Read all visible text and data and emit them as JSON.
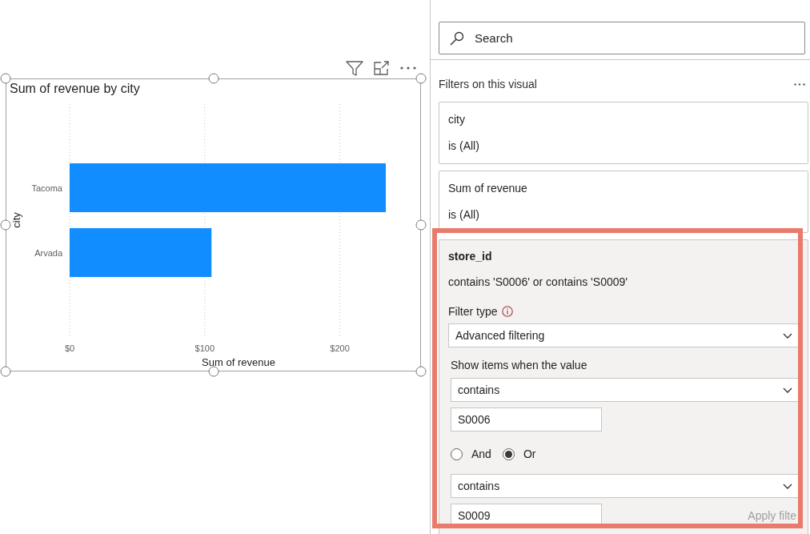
{
  "canvas": {
    "visual": {
      "selected": true,
      "chart_data": {
        "type": "bar",
        "orientation": "horizontal",
        "title": "Sum of revenue by city",
        "xlabel": "Sum of revenue",
        "ylabel": "city",
        "categories": [
          "Tacoma",
          "Arvada"
        ],
        "series": [
          {
            "color": "#118dff",
            "values": [
              234,
              105
            ]
          }
        ],
        "xlim": [
          0,
          234
        ],
        "xticks": [
          {
            "value": 0,
            "label": "$0"
          },
          {
            "value": 100,
            "label": "$100"
          },
          {
            "value": 200,
            "label": "$200"
          }
        ]
      }
    }
  },
  "filters_pane": {
    "search": {
      "placeholder": "Search"
    },
    "section_title": "Filters on this visual",
    "cards": [
      {
        "field": "city",
        "summary": "is (All)",
        "expanded": false,
        "highlighted": false
      },
      {
        "field": "Sum of revenue",
        "summary": "is (All)",
        "expanded": false,
        "highlighted": false
      },
      {
        "field": "store_id",
        "summary": "contains 'S0006' or contains 'S0009'",
        "expanded": true,
        "highlighted": true,
        "filter_type_label": "Filter type",
        "filter_type": "Advanced filtering",
        "condition_label": "Show items when the value",
        "conditions": [
          {
            "operator": "contains",
            "value": "S0006"
          },
          {
            "operator": "contains",
            "value": "S0009"
          }
        ],
        "logic": [
          {
            "label": "And",
            "selected": false
          },
          {
            "label": "Or",
            "selected": true
          }
        ],
        "apply": {
          "label": "Apply filte",
          "disabled": true
        }
      }
    ]
  }
}
